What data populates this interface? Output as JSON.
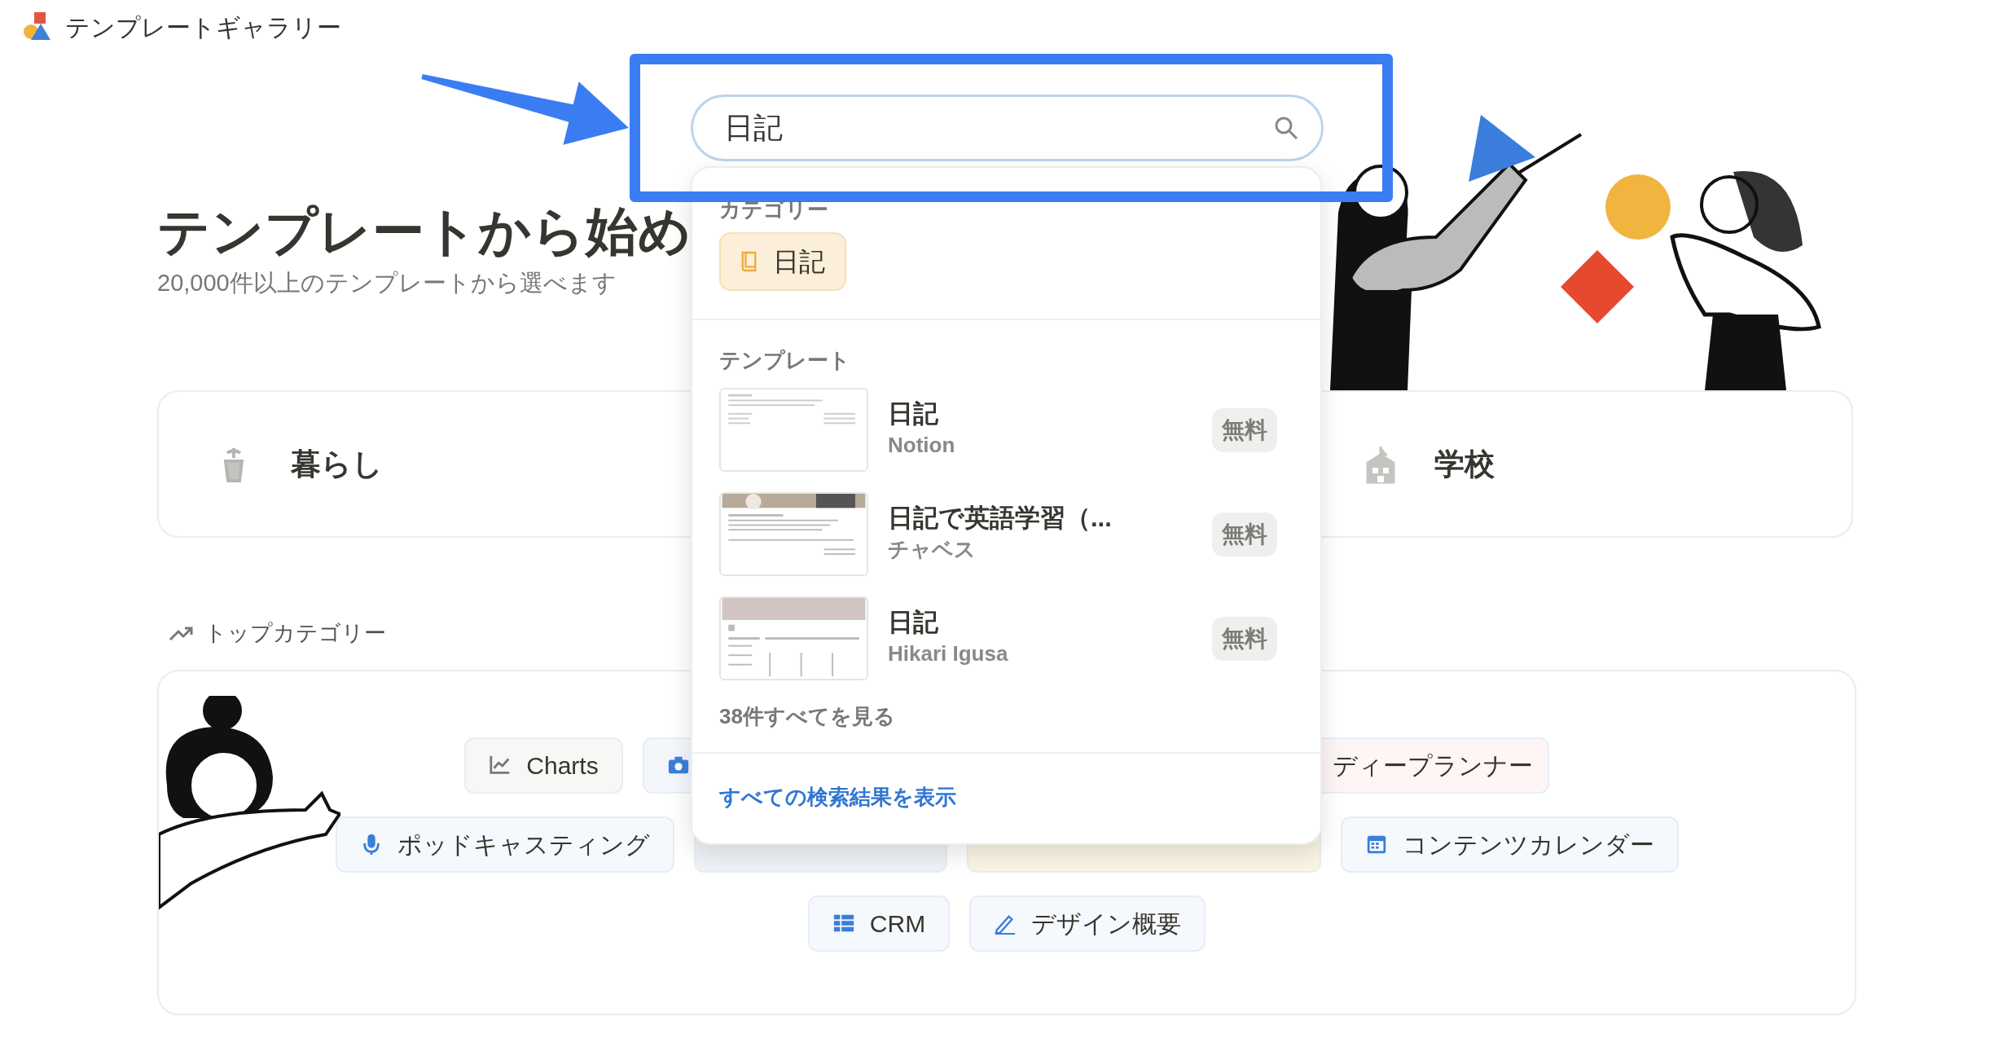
{
  "header": {
    "title": "テンプレートギャラリー"
  },
  "hero": {
    "title": "テンプレートから始め",
    "subtitle": "20,000件以上のテンプレートから選べます"
  },
  "category_cards": [
    {
      "label": "暮らし"
    },
    {
      "label": "学校"
    }
  ],
  "top_categories": {
    "heading": "トップカテゴリー",
    "rows": [
      [
        {
          "kind": "chart",
          "label": "Charts",
          "color": "#f7f7f5"
        },
        {
          "kind": "camera",
          "color": "#f3f7fc"
        },
        {
          "kind": "cut",
          "label": "ディープランナー",
          "color": "#fdf6f5"
        }
      ],
      [
        {
          "kind": "mic",
          "label": "ポッドキャスティング",
          "color": "#f5f9fd"
        },
        {
          "kind": "startup",
          "color": "#eef2f6"
        },
        {
          "kind": "travel",
          "color": "#fbf3e3"
        },
        {
          "kind": "calendar",
          "label": "コンテンツカレンダー",
          "color": "#f5f9fd"
        }
      ],
      [
        {
          "kind": "grid",
          "label": "CRM",
          "color": "#f5f9fd"
        },
        {
          "kind": "pen",
          "label": "デザイン概要",
          "color": "#f5f9fd"
        }
      ]
    ]
  },
  "search": {
    "value": "日記"
  },
  "dropdown": {
    "category_heading": "カテゴリー",
    "category_chip": "日記",
    "template_heading": "テンプレート",
    "templates": [
      {
        "title": "日記",
        "author": "Notion",
        "price": "無料"
      },
      {
        "title": "日記で英語学習（...",
        "author": "チャベス",
        "price": "無料"
      },
      {
        "title": "日記",
        "author": "Hikari Igusa",
        "price": "無料"
      }
    ],
    "see_all": "38件すべてを見る",
    "show_all_results": "すべての検索結果を表示"
  }
}
